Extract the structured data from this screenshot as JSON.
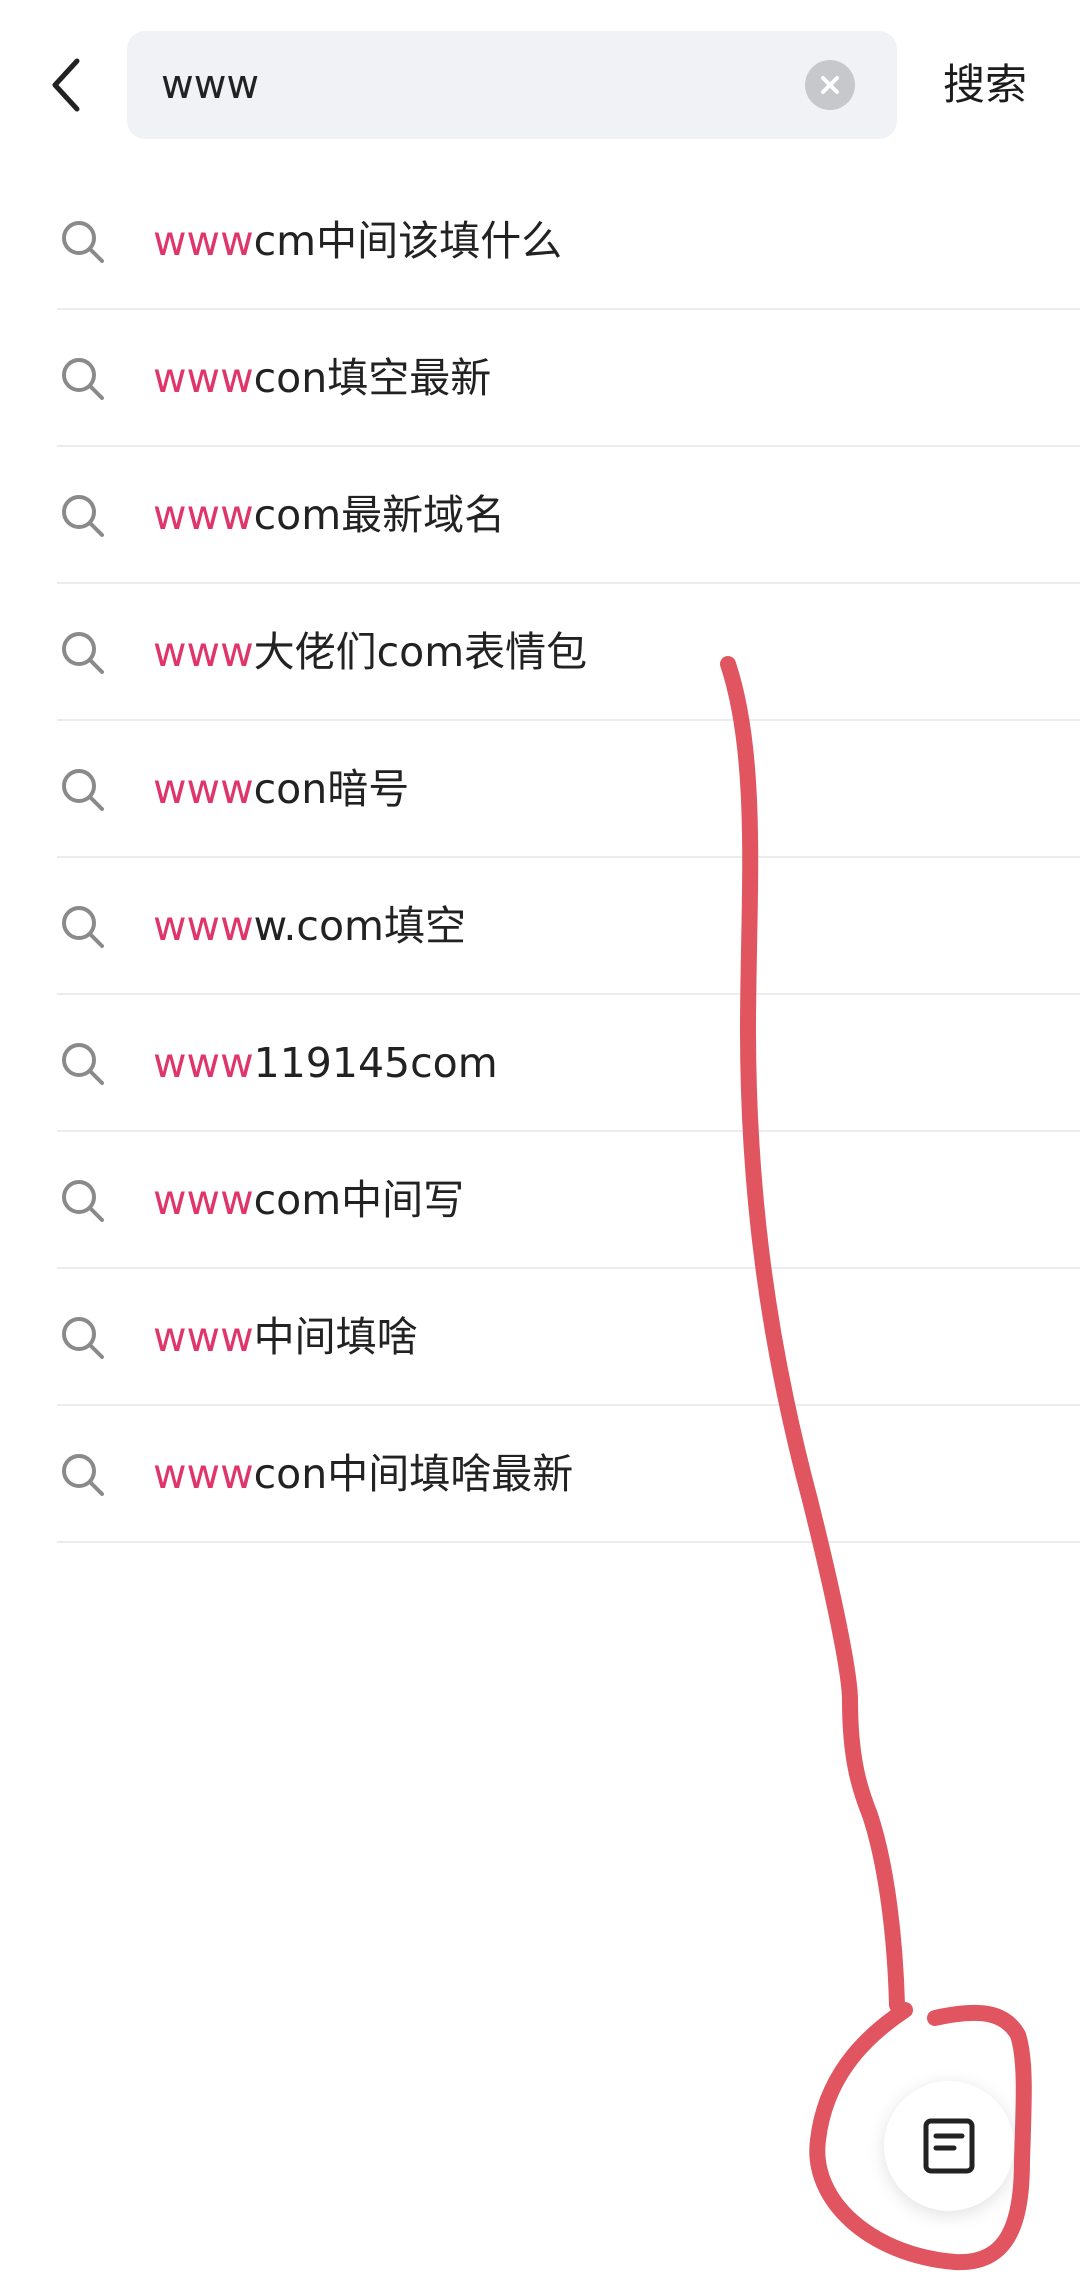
{
  "search": {
    "query": "www",
    "placeholder": "",
    "submit_label": "搜索"
  },
  "icons": {
    "back": "chevron-left-icon",
    "clear": "close-circle-icon",
    "suggestion": "search-icon",
    "fab": "document-icon"
  },
  "suggestions": [
    {
      "match": "www",
      "rest": "cm中间该填什么"
    },
    {
      "match": "www",
      "rest": "con填空最新"
    },
    {
      "match": "www",
      "rest": "com最新域名"
    },
    {
      "match": "www",
      "rest": "大佬们com表情包"
    },
    {
      "match": "www",
      "rest": "con暗号"
    },
    {
      "match": "www",
      "rest": "w.com填空"
    },
    {
      "match": "www",
      "rest": "119145com"
    },
    {
      "match": "www",
      "rest": "com中间写"
    },
    {
      "match": "www",
      "rest": "中间填啥"
    },
    {
      "match": "www",
      "rest": "con中间填啥最新"
    }
  ],
  "colors": {
    "highlight": "#e0356b",
    "annotation": "#e05560",
    "search_bg": "#f1f2f6"
  }
}
